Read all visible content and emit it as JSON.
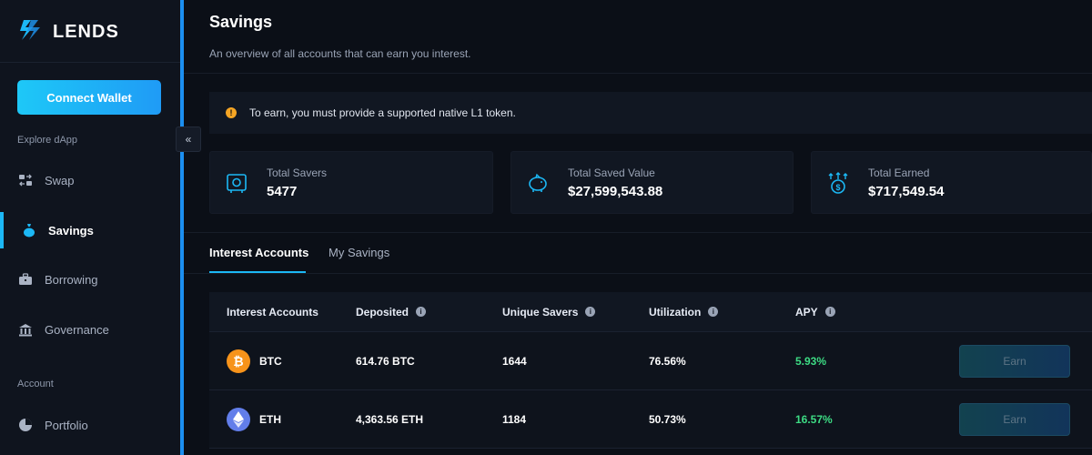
{
  "app": {
    "name": "LENDS"
  },
  "sidebar": {
    "connect_label": "Connect Wallet",
    "section_explore": "Explore dApp",
    "section_account": "Account",
    "items": [
      {
        "label": "Swap",
        "icon": "swap-icon",
        "active": false
      },
      {
        "label": "Savings",
        "icon": "money-bag-icon",
        "active": true
      },
      {
        "label": "Borrowing",
        "icon": "briefcase-icon",
        "active": false
      },
      {
        "label": "Governance",
        "icon": "bank-icon",
        "active": false
      },
      {
        "label": "Portfolio",
        "icon": "pie-chart-icon",
        "active": false
      }
    ],
    "collapse_glyph": "«"
  },
  "header": {
    "title": "Savings",
    "subtitle": "An overview of all accounts that can earn you interest."
  },
  "notice": {
    "text": "To earn, you must provide a supported native L1 token.",
    "icon": "warning-icon"
  },
  "stats": [
    {
      "label": "Total Savers",
      "value": "5477",
      "icon": "vault-icon"
    },
    {
      "label": "Total Saved Value",
      "value": "$27,599,543.88",
      "icon": "piggy-bank-icon"
    },
    {
      "label": "Total Earned",
      "value": "$717,549.54",
      "icon": "dollar-growth-icon"
    }
  ],
  "tabs": [
    {
      "label": "Interest Accounts",
      "active": true
    },
    {
      "label": "My Savings",
      "active": false
    }
  ],
  "table": {
    "headers": [
      "Interest Accounts",
      "Deposited",
      "Unique Savers",
      "Utilization",
      "APY"
    ],
    "rows": [
      {
        "asset": "BTC",
        "deposited": "614.76 BTC",
        "savers": "1644",
        "utilization": "76.56%",
        "apy": "5.93%",
        "action": "Earn"
      },
      {
        "asset": "ETH",
        "deposited": "4,363.56 ETH",
        "savers": "1184",
        "utilization": "50.73%",
        "apy": "16.57%",
        "action": "Earn"
      }
    ]
  },
  "colors": {
    "accent": "#1cb8f5",
    "positive": "#3ddc84",
    "btc": "#f7931a",
    "eth": "#627eea",
    "warning": "#f5a524"
  }
}
